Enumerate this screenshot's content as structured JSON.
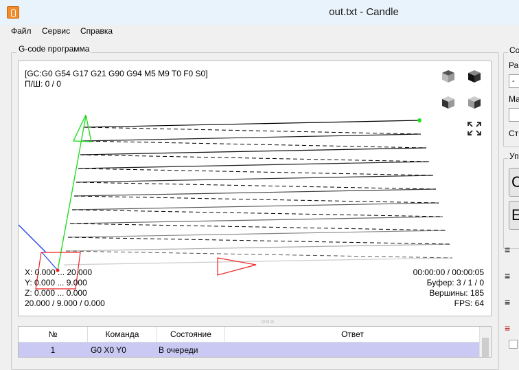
{
  "window": {
    "title": "out.txt - Candle"
  },
  "menu": {
    "items": [
      "Файл",
      "Сервис",
      "Справка"
    ]
  },
  "program_group": {
    "title": "G-code программа"
  },
  "viewer": {
    "status_line_1": "[GC:G0 G54 G17 G21 G90 G94 M5 M9 T0 F0 S0]",
    "status_line_2": "П/Ш: 0 / 0",
    "bounds_x": "X: 0.000 ... 20.000",
    "bounds_y": "Y: 0.000 ... 9.000",
    "bounds_z": "Z: 0.000 ... 0.000",
    "size": "20.000 / 9.000 / 0.000",
    "time": "00:00:00 / 00:00:05",
    "buffer": "Буфер: 3 / 1 / 0",
    "vertices": "Вершины: 185",
    "fps": "FPS: 64"
  },
  "table": {
    "headers": [
      "№",
      "Команда",
      "Состояние",
      "Ответ"
    ],
    "rows": [
      {
        "num": "1",
        "command": "G0 X0 Y0",
        "state": "В очереди",
        "response": ""
      }
    ]
  },
  "right_panel": {
    "title_1": "Со",
    "label_1": "Ра",
    "input_value": "-",
    "label_2": "Ма",
    "label_3": "Ст",
    "title_2": "Уп",
    "button_1": "С",
    "button_2": "Е",
    "collapsed_1": "≡",
    "collapsed_2": "≡",
    "collapsed_3": "≡",
    "collapsed_4": "≡"
  },
  "colors": {
    "window_bg": "#f0f0f0",
    "titlebar_bg": "#e9f3fb",
    "selected_row": "#c9c9f4",
    "toolpath_feed": "#000000",
    "toolpath_rapid": "#000000",
    "axis_y": "#22dd22",
    "axis_x": "#ee2222",
    "axis_z": "#2244ee"
  }
}
